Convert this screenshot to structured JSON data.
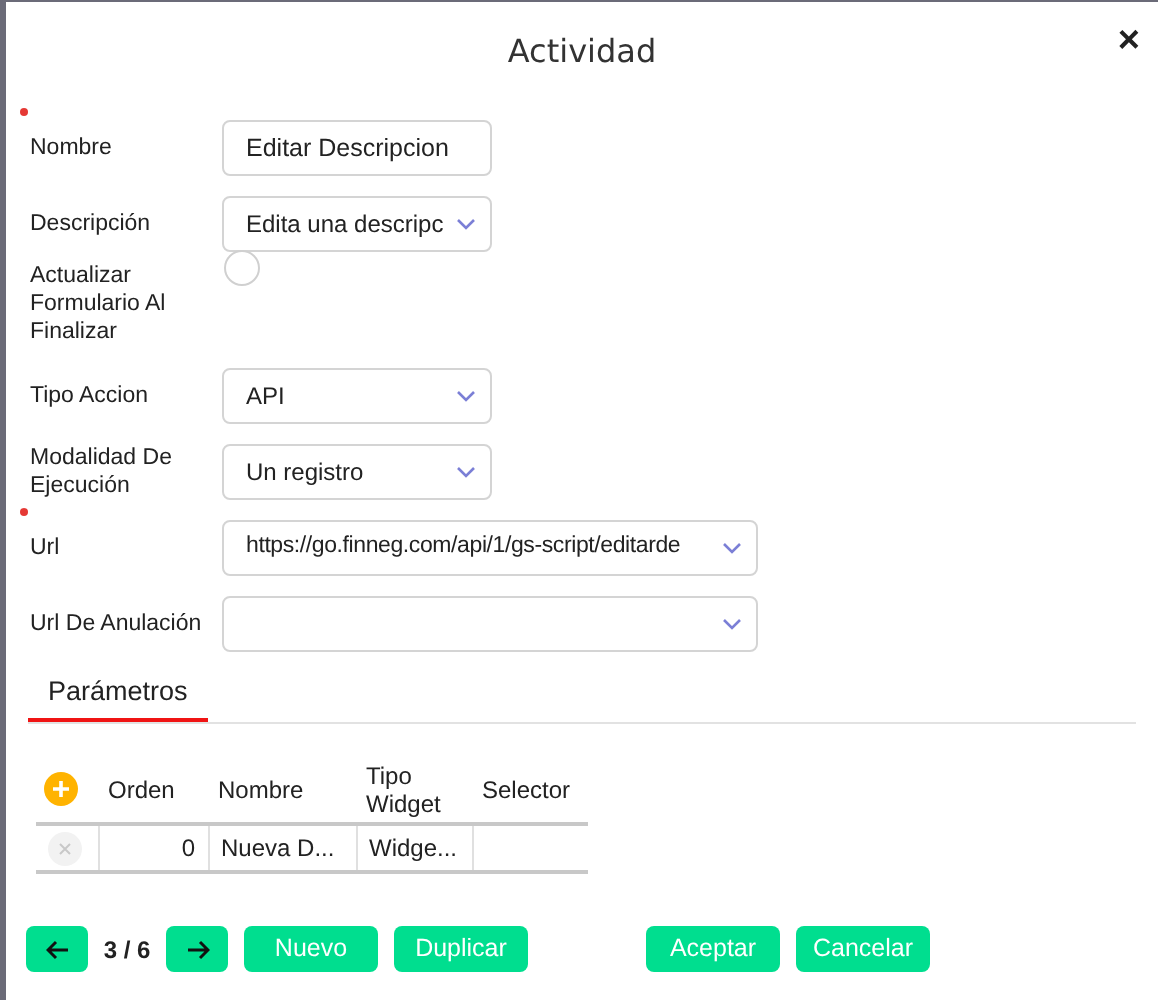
{
  "dialog": {
    "title": "Actividad",
    "close": "×"
  },
  "fields": [
    {
      "kind": "text",
      "label": "Nombre",
      "required": true,
      "value": "Editar Descripcion"
    },
    {
      "kind": "select",
      "label": "Descripción",
      "required": false,
      "value": "Edita una descripc"
    },
    {
      "kind": "toggle",
      "label": "Actualizar Formulario Al Finalizar",
      "required": false,
      "checked": false
    },
    {
      "kind": "select",
      "label": "Tipo Accion",
      "required": false,
      "value": "API"
    },
    {
      "kind": "select",
      "label": "Modalidad De Ejecución",
      "required": false,
      "value": "Un registro"
    },
    {
      "kind": "combo",
      "label": "Url",
      "required": true,
      "value": "https://go.finneg.com/api/1/gs-script/editarde"
    },
    {
      "kind": "combo",
      "label": "Url De Anulación",
      "required": false
    }
  ],
  "tabs": [
    {
      "label": "Parámetros",
      "selected": true
    }
  ],
  "table": {
    "columns": [
      "Orden",
      "Nombre",
      "Tipo Widget",
      "Selector"
    ],
    "rows": [
      {
        "orden": "0",
        "nombre": "Nueva D...",
        "tipo_widget": "Widge..."
      }
    ]
  },
  "footer": {
    "pager": "3 / 6",
    "buttons_left": [
      "Nuevo",
      "Duplicar"
    ],
    "buttons_right": [
      "Aceptar",
      "Cancelar"
    ]
  }
}
